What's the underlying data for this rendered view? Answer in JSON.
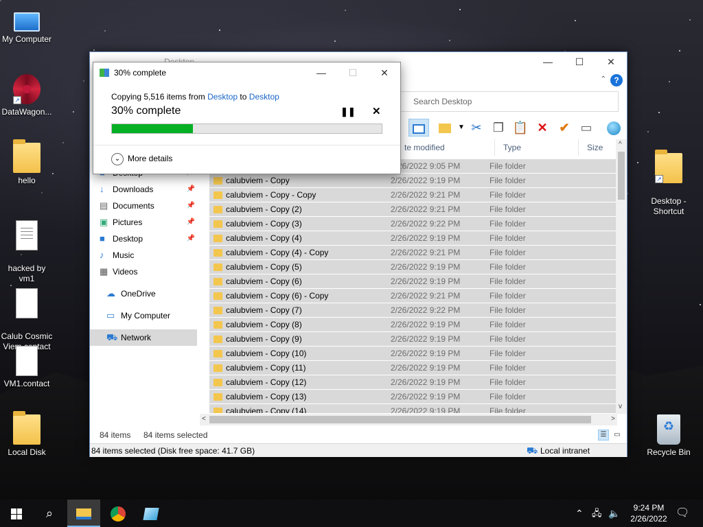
{
  "desktop": {
    "icons_left": [
      {
        "label": "My Computer",
        "icon": "computer-icon"
      },
      {
        "label": "DataWagon...",
        "icon": "mandala-icon"
      },
      {
        "label": "hello",
        "icon": "folder-icon"
      },
      {
        "label": "hacked by\nvm1",
        "icon": "text-document-icon"
      },
      {
        "label": "Calub Cosmic\nViem.contact",
        "icon": "contact-file-icon"
      },
      {
        "label": "VM1.contact",
        "icon": "contact-file-icon"
      },
      {
        "label": "Local Disk",
        "icon": "folder-icon"
      }
    ],
    "icons_right": [
      {
        "label": "Desktop -\nShortcut",
        "icon": "folder-shortcut-icon"
      },
      {
        "label": "Recycle Bin",
        "icon": "recycle-bin-icon"
      }
    ]
  },
  "explorer": {
    "title": "Desktop",
    "search_placeholder": "Search Desktop",
    "columns": {
      "date": "te modified",
      "type": "Type",
      "size": "Size"
    },
    "nav_items": [
      {
        "label": "Desktop",
        "icon": "desktop-icon",
        "pinned": true
      },
      {
        "label": "Downloads",
        "icon": "download-icon",
        "pinned": true
      },
      {
        "label": "Documents",
        "icon": "documents-icon",
        "pinned": true
      },
      {
        "label": "Pictures",
        "icon": "pictures-icon",
        "pinned": true
      },
      {
        "label": "Desktop",
        "icon": "desktop-icon",
        "pinned": true
      },
      {
        "label": "Music",
        "icon": "music-icon",
        "pinned": false
      },
      {
        "label": "Videos",
        "icon": "video-icon",
        "pinned": false
      },
      {
        "label": "OneDrive",
        "icon": "cloud-icon",
        "pinned": false
      },
      {
        "label": "My Computer",
        "icon": "computer-icon",
        "pinned": false
      },
      {
        "label": "Network",
        "icon": "network-icon",
        "pinned": false
      }
    ],
    "files": [
      {
        "name": "",
        "date": "2/26/2022 9:05 PM",
        "type": "File folder"
      },
      {
        "name": "calubviem - Copy",
        "date": "2/26/2022 9:19 PM",
        "type": "File folder"
      },
      {
        "name": "calubviem - Copy - Copy",
        "date": "2/26/2022 9:21 PM",
        "type": "File folder"
      },
      {
        "name": "calubviem - Copy (2)",
        "date": "2/26/2022 9:21 PM",
        "type": "File folder"
      },
      {
        "name": "calubviem - Copy (3)",
        "date": "2/26/2022 9:22 PM",
        "type": "File folder"
      },
      {
        "name": "calubviem - Copy (4)",
        "date": "2/26/2022 9:19 PM",
        "type": "File folder"
      },
      {
        "name": "calubviem - Copy (4) - Copy",
        "date": "2/26/2022 9:21 PM",
        "type": "File folder"
      },
      {
        "name": "calubviem - Copy (5)",
        "date": "2/26/2022 9:19 PM",
        "type": "File folder"
      },
      {
        "name": "calubviem - Copy (6)",
        "date": "2/26/2022 9:19 PM",
        "type": "File folder"
      },
      {
        "name": "calubviem - Copy (6) - Copy",
        "date": "2/26/2022 9:21 PM",
        "type": "File folder"
      },
      {
        "name": "calubviem - Copy (7)",
        "date": "2/26/2022 9:22 PM",
        "type": "File folder"
      },
      {
        "name": "calubviem - Copy (8)",
        "date": "2/26/2022 9:19 PM",
        "type": "File folder"
      },
      {
        "name": "calubviem - Copy (9)",
        "date": "2/26/2022 9:19 PM",
        "type": "File folder"
      },
      {
        "name": "calubviem - Copy (10)",
        "date": "2/26/2022 9:19 PM",
        "type": "File folder"
      },
      {
        "name": "calubviem - Copy (11)",
        "date": "2/26/2022 9:19 PM",
        "type": "File folder"
      },
      {
        "name": "calubviem - Copy (12)",
        "date": "2/26/2022 9:19 PM",
        "type": "File folder"
      },
      {
        "name": "calubviem - Copy (13)",
        "date": "2/26/2022 9:19 PM",
        "type": "File folder"
      },
      {
        "name": "calubviem - Copy (14)",
        "date": "2/26/2022 9:19 PM",
        "type": "File folder"
      }
    ],
    "item_count": "84 items",
    "selected_count": "84 items selected",
    "status_text": "84 items selected (Disk free space: 41.7 GB)",
    "zone": "Local intranet"
  },
  "copy_dialog": {
    "title": "30% complete",
    "copying_prefix": "Copying 5,516 items from ",
    "source": "Desktop",
    "to_text": " to ",
    "destination": "Desktop",
    "percent_label": "30% complete",
    "progress": 0.3,
    "more_details": "More details"
  },
  "taskbar": {
    "time": "9:24 PM",
    "date": "2/26/2022"
  },
  "colors": {
    "progress_fill": "#06b025",
    "link": "#1a66c9",
    "selection": "#d9d9d9"
  }
}
